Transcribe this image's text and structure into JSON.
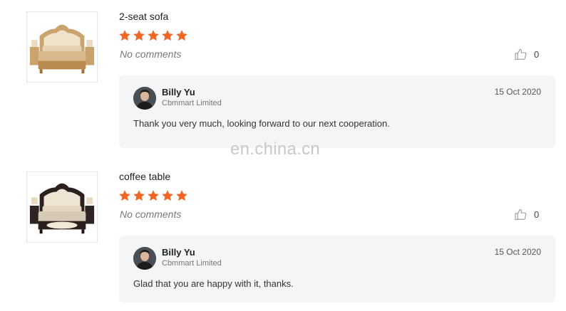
{
  "reviews": [
    {
      "product_name": "2-seat sofa",
      "rating": 5,
      "comment": "No comments",
      "likes": "0",
      "reply": {
        "name": "Billy Yu",
        "company": "Cbmmart Limited",
        "date": "15 Oct 2020",
        "text": "Thank you very much, looking forward to our next cooperation."
      }
    },
    {
      "product_name": "coffee table",
      "rating": 5,
      "comment": "No comments",
      "likes": "0",
      "reply": {
        "name": "Billy Yu",
        "company": "Cbmmart Limited",
        "date": "15 Oct 2020",
        "text": "Glad that you are happy with it, thanks."
      }
    }
  ],
  "watermark": "en.china.cn",
  "colors": {
    "star": "#f26522",
    "reply_bg": "#f4f5f7",
    "watermark": "#c9c9c9"
  },
  "icons": {
    "rating": "star-icon",
    "like": "thumbs-up-icon"
  }
}
